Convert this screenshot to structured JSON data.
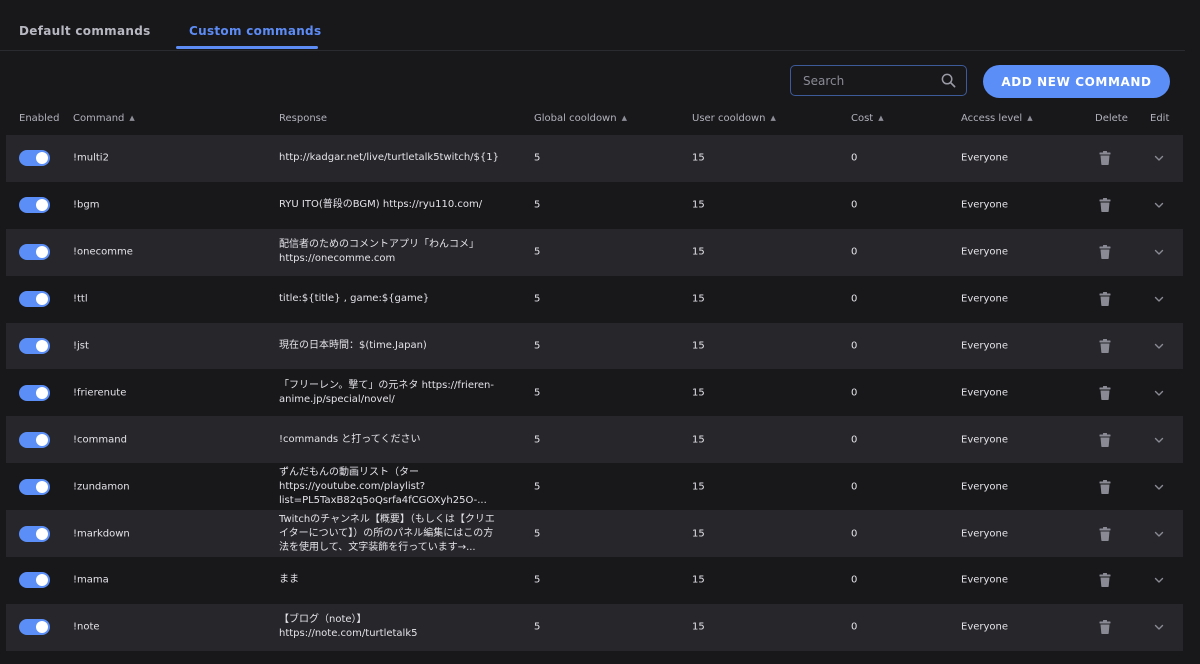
{
  "tabs": {
    "default": "Default commands",
    "custom": "Custom commands"
  },
  "toolbar": {
    "search_placeholder": "Search",
    "add_label": "ADD NEW COMMAND"
  },
  "columns": {
    "enabled": "Enabled",
    "command": "Command",
    "response": "Response",
    "global_cooldown": "Global cooldown",
    "user_cooldown": "User cooldown",
    "cost": "Cost",
    "access_level": "Access level",
    "delete": "Delete",
    "edit": "Edit"
  },
  "rows": [
    {
      "command": "!multi2",
      "response": "http://kadgar.net/live/turtletalk5twitch/${1}",
      "global": "5",
      "user": "15",
      "cost": "0",
      "access": "Everyone"
    },
    {
      "command": "!bgm",
      "response": "RYU ITO(普段のBGM) https://ryu110.com/",
      "global": "5",
      "user": "15",
      "cost": "0",
      "access": "Everyone"
    },
    {
      "command": "!onecomme",
      "response": "配信者のためのコメントアプリ「わんコメ」 https://onecomme.com",
      "global": "5",
      "user": "15",
      "cost": "0",
      "access": "Everyone"
    },
    {
      "command": "!ttl",
      "response": "title:${title} , game:${game}",
      "global": "5",
      "user": "15",
      "cost": "0",
      "access": "Everyone"
    },
    {
      "command": "!jst",
      "response": "現在の日本時間：$(time.Japan)",
      "global": "5",
      "user": "15",
      "cost": "0",
      "access": "Everyone"
    },
    {
      "command": "!frierenute",
      "response": "「フリーレン。撃て」の元ネタ https://frieren-anime.jp/special/novel/",
      "global": "5",
      "user": "15",
      "cost": "0",
      "access": "Everyone"
    },
    {
      "command": "!command",
      "response": "!commands と打ってください",
      "global": "5",
      "user": "15",
      "cost": "0",
      "access": "Everyone"
    },
    {
      "command": "!zundamon",
      "response": "ずんだもんの動画リスト（ター https://youtube.com/playlist?list=PL5TaxB82q5oQsrfa4fCGOXyh25O-...",
      "global": "5",
      "user": "15",
      "cost": "0",
      "access": "Everyone"
    },
    {
      "command": "!markdown",
      "response": "Twitchのチャンネル【概要】（もしくは【クリエイターについて】）の所のパネル編集にはこの方法を使用して、文字装飾を行っています→...",
      "global": "5",
      "user": "15",
      "cost": "0",
      "access": "Everyone"
    },
    {
      "command": "!mama",
      "response": "まま",
      "global": "5",
      "user": "15",
      "cost": "0",
      "access": "Everyone"
    },
    {
      "command": "!note",
      "response": "【ブログ（note）】 https://note.com/turtletalk5",
      "global": "5",
      "user": "15",
      "cost": "0",
      "access": "Everyone"
    }
  ],
  "colors": {
    "accent": "#5b8ef7",
    "background": "#18181b",
    "row_alt": "#26262b"
  },
  "icons": {
    "search": "search-icon",
    "delete": "trash-icon",
    "expand": "chevron-down-icon"
  }
}
